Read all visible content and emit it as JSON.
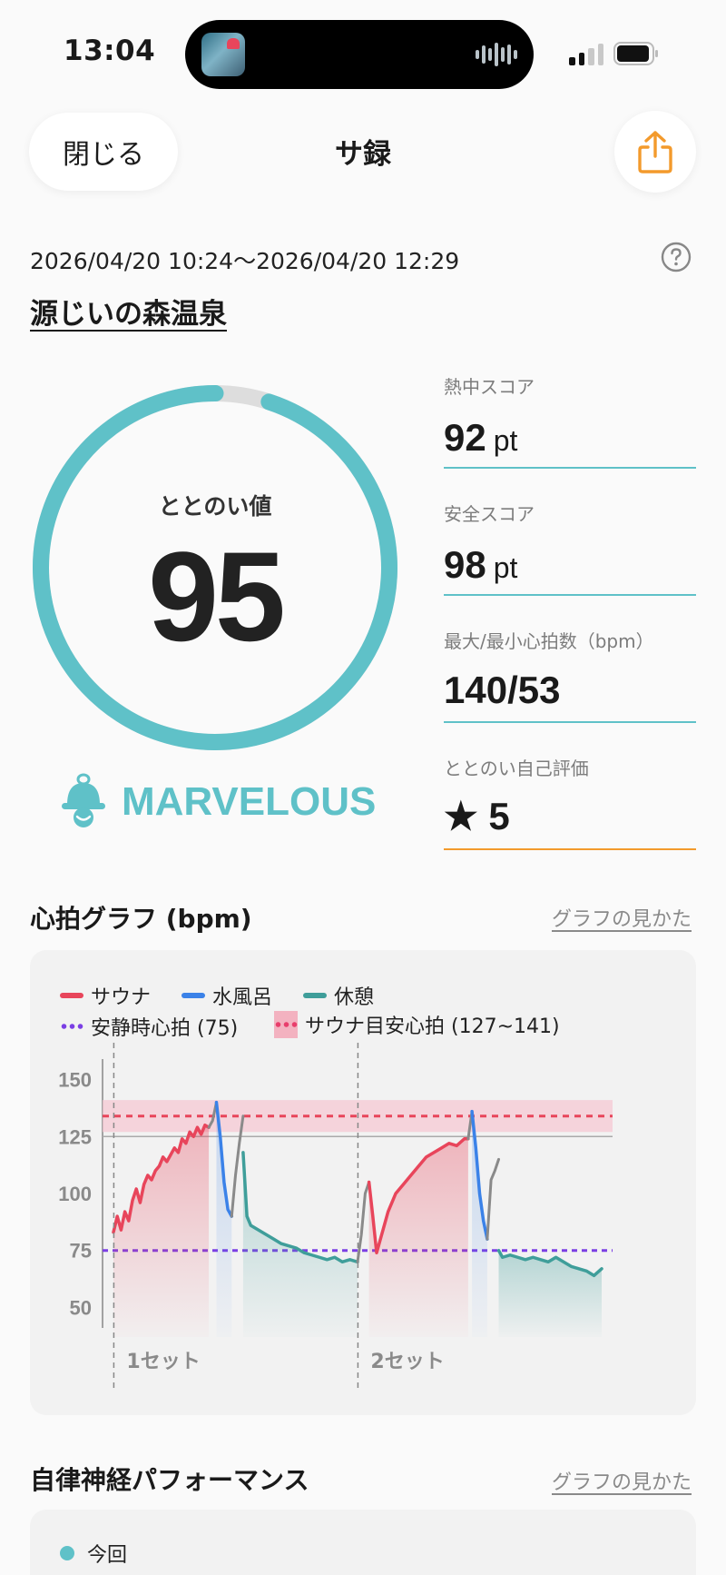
{
  "status_bar": {
    "time": "13:04"
  },
  "nav": {
    "close_label": "閉じる",
    "title": "サ録"
  },
  "session": {
    "date_range": "2026/04/20 10:24〜2026/04/20 12:29",
    "location": "源じいの森温泉"
  },
  "gauge": {
    "label": "ととのい値",
    "value": "95",
    "progress": 0.95,
    "rank": "MARVELOUS"
  },
  "stats": [
    {
      "label": "熱中スコア",
      "value": "92",
      "unit": "pt"
    },
    {
      "label": "安全スコア",
      "value": "98",
      "unit": "pt"
    },
    {
      "label": "最大/最小心拍数（bpm）",
      "value": "140/53",
      "unit": ""
    },
    {
      "label": "ととのい自己評価",
      "value": "★ 5",
      "unit": ""
    }
  ],
  "heart_section": {
    "title": "心拍グラフ (bpm)",
    "help_link": "グラフの見かた",
    "legend": {
      "sauna": "サウナ",
      "cold": "水風呂",
      "rest": "休憩",
      "resting": "安静時心拍 (75)",
      "target": "サウナ目安心拍 (127~141)"
    },
    "set_labels": [
      "1セット",
      "2セット"
    ]
  },
  "ans_section": {
    "title": "自律神経パフォーマンス",
    "help_link": "グラフの見かた",
    "legend_now": "今回"
  },
  "colors": {
    "accent": "#5fc1c8",
    "sauna": "#e8455b",
    "cold": "#3b82e8",
    "rest": "#3f9e9a",
    "transition": "#8a8a8a",
    "resting_line": "#7b3fe4",
    "target_band": "#f6c6d1",
    "share": "#f39a2c"
  },
  "chart_data": {
    "type": "line",
    "ylabel": "bpm",
    "yticks": [
      150,
      125,
      100,
      75,
      50
    ],
    "ylim": [
      45,
      155
    ],
    "xlim": [
      0,
      64
    ],
    "resting_hr": 75,
    "target_band": [
      127,
      141
    ],
    "set_starts": [
      1,
      33
    ],
    "series": [
      {
        "phase": "sauna",
        "x": [
          0,
          0.5,
          1,
          1.5,
          2,
          2.5,
          3,
          3.5,
          4,
          4.5,
          5,
          5.5,
          6,
          6.5,
          7,
          7.5,
          8,
          8.5,
          9,
          9.5,
          10,
          10.5,
          11,
          11.5,
          12,
          12.5
        ],
        "y": [
          83,
          90,
          84,
          92,
          88,
          97,
          102,
          96,
          104,
          108,
          106,
          110,
          112,
          116,
          114,
          117,
          120,
          118,
          124,
          122,
          127,
          125,
          129,
          126,
          130,
          129
        ]
      },
      {
        "phase": "transition",
        "x": [
          12.5,
          13,
          13.5
        ],
        "y": [
          129,
          132,
          140
        ]
      },
      {
        "phase": "cold",
        "x": [
          13.5,
          14,
          14.5,
          15,
          15.5
        ],
        "y": [
          140,
          125,
          105,
          93,
          90
        ]
      },
      {
        "phase": "transition",
        "x": [
          15.5,
          16,
          16.5,
          17
        ],
        "y": [
          90,
          108,
          122,
          134
        ]
      },
      {
        "phase": "rest",
        "x": [
          17,
          17.5,
          18,
          19,
          20,
          21,
          22,
          23,
          24,
          25,
          26,
          27,
          28,
          29,
          30,
          31,
          32
        ],
        "y": [
          118,
          90,
          86,
          84,
          82,
          80,
          78,
          77,
          76,
          74,
          73,
          72,
          71,
          72,
          70,
          71,
          70
        ]
      },
      {
        "phase": "transition",
        "x": [
          32,
          32.5,
          33,
          33.5
        ],
        "y": [
          70,
          82,
          100,
          105
        ]
      },
      {
        "phase": "sauna",
        "x": [
          33.5,
          34,
          34.5,
          35,
          35.5,
          36,
          36.5,
          37,
          38,
          39,
          40,
          41,
          42,
          43,
          44,
          45,
          46,
          46.5
        ],
        "y": [
          105,
          90,
          74,
          80,
          86,
          92,
          96,
          100,
          104,
          108,
          112,
          116,
          118,
          120,
          122,
          121,
          124,
          124
        ]
      },
      {
        "phase": "transition",
        "x": [
          46.5,
          47
        ],
        "y": [
          124,
          136
        ]
      },
      {
        "phase": "cold",
        "x": [
          47,
          47.5,
          48,
          48.5,
          49
        ],
        "y": [
          136,
          120,
          100,
          88,
          80
        ]
      },
      {
        "phase": "transition",
        "x": [
          49,
          49.5,
          50,
          50.5
        ],
        "y": [
          80,
          106,
          110,
          115
        ]
      },
      {
        "phase": "rest",
        "x": [
          50.5,
          51,
          52,
          53,
          54,
          55,
          56,
          57,
          58,
          59,
          60,
          61,
          62,
          63,
          64
        ],
        "y": [
          75,
          72,
          73,
          72,
          71,
          72,
          71,
          70,
          72,
          70,
          68,
          67,
          66,
          64,
          67
        ]
      }
    ]
  }
}
